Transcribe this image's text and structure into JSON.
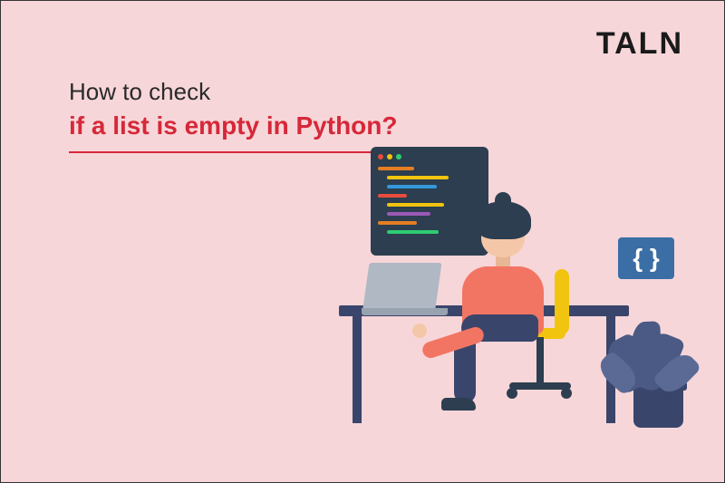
{
  "logo": "TALN",
  "heading": {
    "line1": "How to check",
    "line2": "if a list is empty in Python?"
  },
  "braces": "{ }"
}
